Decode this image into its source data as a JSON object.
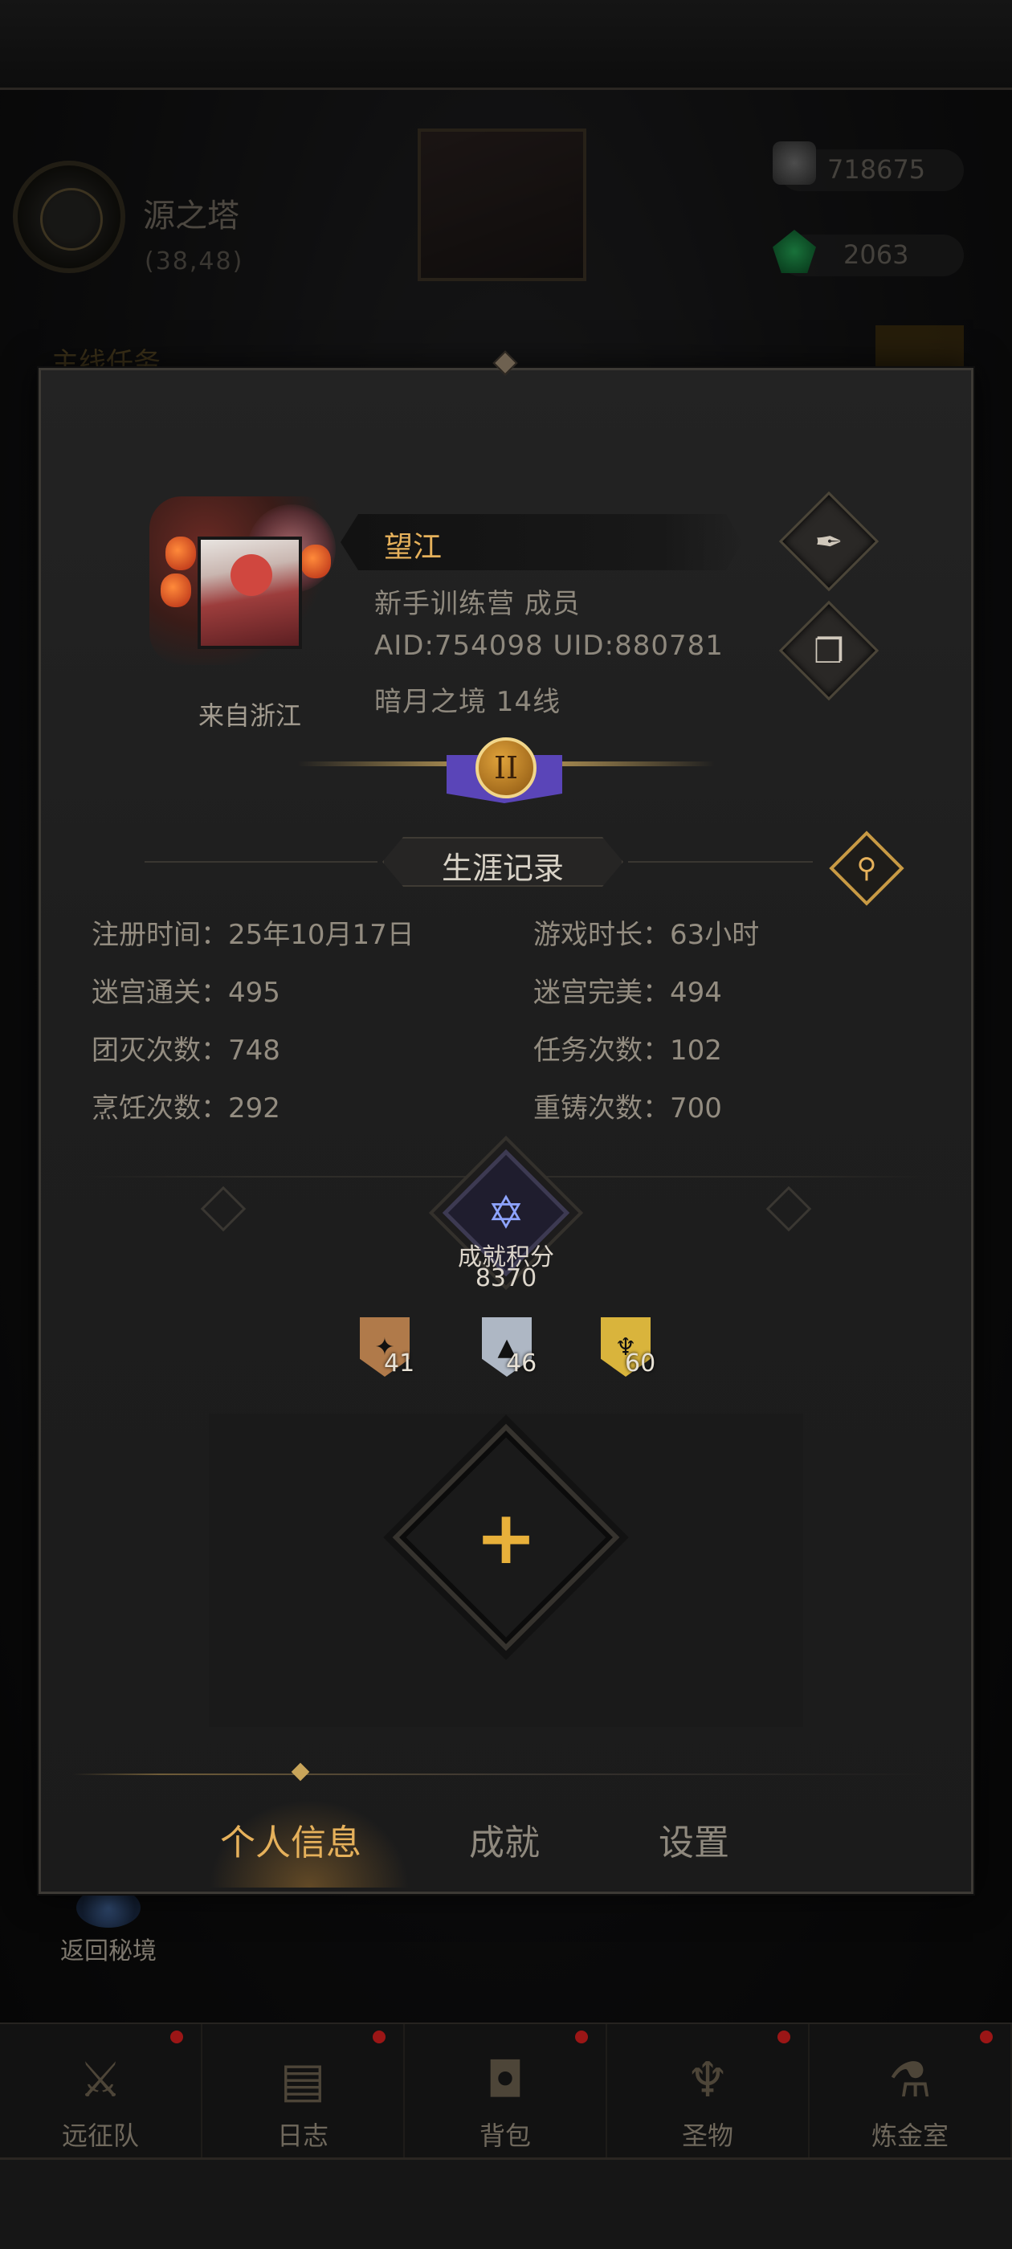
{
  "background": {
    "location": {
      "name": "源之塔",
      "coords": "(38,48)"
    },
    "resources": [
      {
        "icon": "ore-stone-icon",
        "value": "718675"
      },
      {
        "icon": "green-gem-icon",
        "value": "2063"
      }
    ],
    "mission_label": "主线任务",
    "return_label": "返回秘境"
  },
  "profile": {
    "name": "望江",
    "guild": "新手训练营   成员",
    "ids": "AID:754098 UID:880781",
    "server": "暗月之境  14线",
    "origin": "来自浙江",
    "rank_numeral": "II"
  },
  "career": {
    "title": "生涯记录",
    "stats": [
      {
        "label": "注册时间",
        "value": "25年10月17日",
        "text": "注册时间：25年10月17日"
      },
      {
        "label": "游戏时长",
        "value": "63小时",
        "text": "游戏时长：63小时"
      },
      {
        "label": "迷宫通关",
        "value": "495",
        "text": "迷宫通关：495"
      },
      {
        "label": "迷宫完美",
        "value": "494",
        "text": "迷宫完美：494"
      },
      {
        "label": "团灭次数",
        "value": "748",
        "text": "团灭次数：748"
      },
      {
        "label": "任务次数",
        "value": "102",
        "text": "任务次数：102"
      },
      {
        "label": "烹饪次数",
        "value": "292",
        "text": "烹饪次数：292"
      },
      {
        "label": "重铸次数",
        "value": "700",
        "text": "重铸次数：700"
      }
    ]
  },
  "achievement": {
    "label": "成就积分",
    "score": "8370",
    "tiers": [
      {
        "name": "bronze",
        "count": "41",
        "color": "#b07a4a"
      },
      {
        "name": "silver",
        "count": "46",
        "color": "#aeb7c4"
      },
      {
        "name": "gold",
        "count": "60",
        "color": "#d9b43c"
      }
    ]
  },
  "tabs": [
    {
      "label": "个人信息",
      "active": true
    },
    {
      "label": "成就",
      "active": false
    },
    {
      "label": "设置",
      "active": false
    }
  ],
  "bottom_nav": [
    {
      "label": "远征队",
      "icon": "helmet-icon",
      "glyph": "⚔"
    },
    {
      "label": "日志",
      "icon": "journal-icon",
      "glyph": "▤"
    },
    {
      "label": "背包",
      "icon": "backpack-icon",
      "glyph": "◘"
    },
    {
      "label": "圣物",
      "icon": "chalice-icon",
      "glyph": "♆"
    },
    {
      "label": "炼金室",
      "icon": "alchemy-icon",
      "glyph": "⚗"
    }
  ],
  "colors": {
    "accent_gold": "#e6b15b",
    "notify_red": "#9b1616",
    "panel": "#1e1e1e"
  }
}
